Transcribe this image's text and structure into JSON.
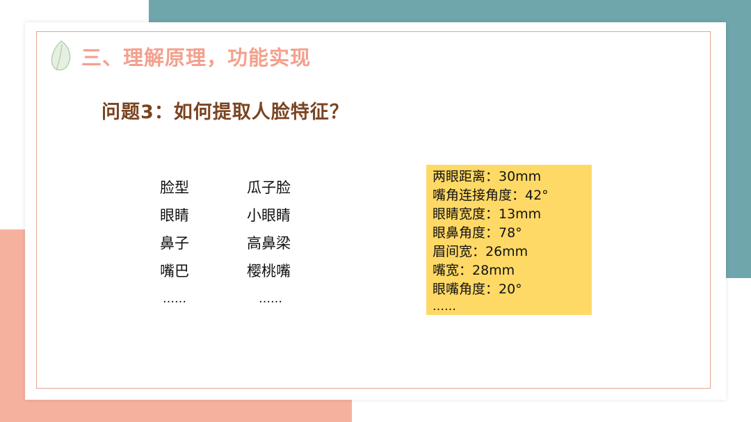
{
  "section_title": "三、理解原理，功能实现",
  "question": "问题3：如何提取人脸特征？",
  "feature_table": [
    {
      "name": "脸型",
      "value": "瓜子脸"
    },
    {
      "name": "眼睛",
      "value": "小眼睛"
    },
    {
      "name": "鼻子",
      "value": "高鼻梁"
    },
    {
      "name": "嘴巴",
      "value": "樱桃嘴"
    },
    {
      "name": "……",
      "value": "……"
    }
  ],
  "measurements": [
    "两眼距离：30mm",
    "嘴角连接角度：42°",
    "眼睛宽度：13mm",
    "眼鼻角度：78°",
    "眉间宽：26mm",
    "嘴宽：28mm",
    "眼嘴角度：20°",
    "……"
  ],
  "colors": {
    "teal_background": "#6fa6ac",
    "salmon_background": "#f6b19e",
    "title": "#f4a08d",
    "question": "#7a4420",
    "note_box": "#ffd966",
    "frame": "#e1a48d"
  },
  "icons": {
    "title_decoration": "leaf-icon"
  }
}
